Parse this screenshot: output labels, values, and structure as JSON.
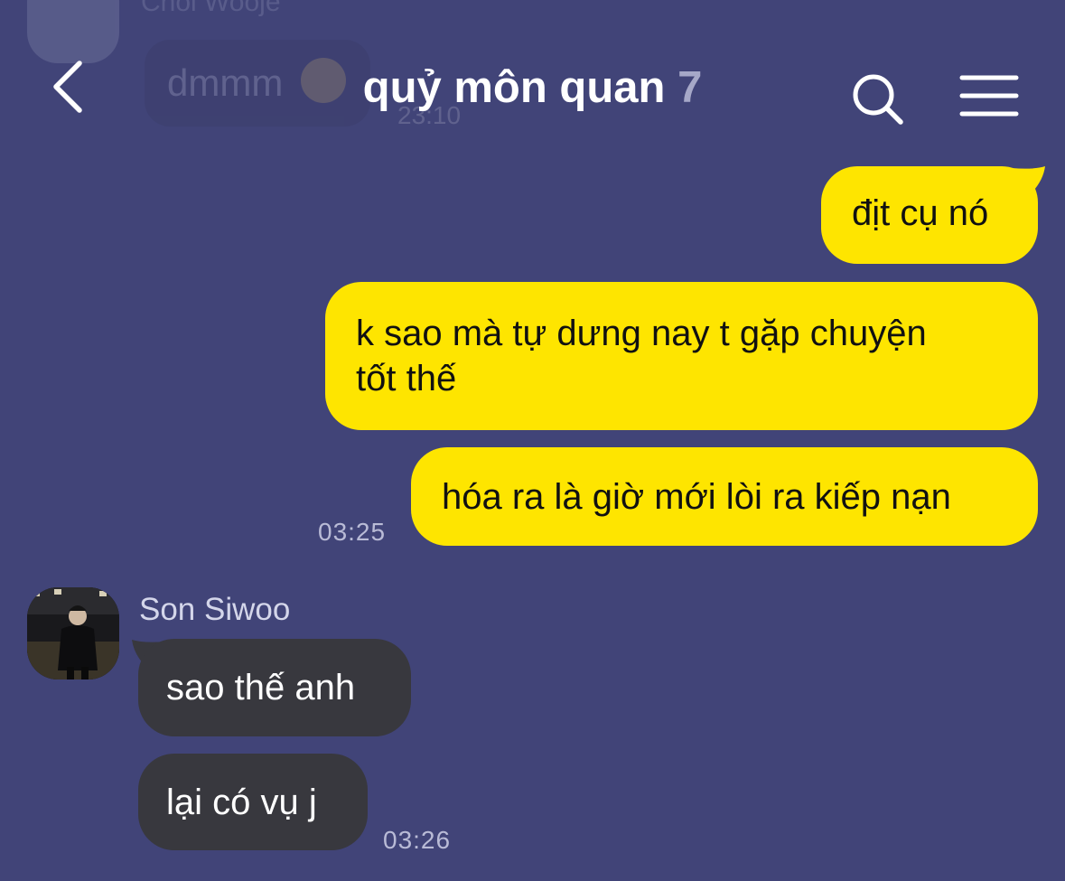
{
  "previous_message": {
    "sender": "Choi Wooje",
    "text": "dmmm",
    "time": "23:10"
  },
  "header": {
    "title": "quỷ môn quan",
    "member_count": "7",
    "back_icon": "chevron-left-icon",
    "search_icon": "search-icon",
    "menu_icon": "hamburger-menu-icon"
  },
  "messages": {
    "sent": [
      {
        "text": "địt cụ nó"
      },
      {
        "text_lines": [
          "k sao mà tự dưng nay t gặp chuyện",
          "tốt thế"
        ]
      },
      {
        "text": "hóa ra là giờ mới lòi ra kiếp nạn"
      }
    ],
    "sent_time": "03:25",
    "received_group": {
      "sender": "Son Siwoo",
      "messages": [
        {
          "text": "sao thế anh"
        },
        {
          "text": "lại có vụ j"
        }
      ],
      "time": "03:26"
    }
  },
  "colors": {
    "background": "#414478",
    "sent_bubble": "#fee500",
    "received_bubble": "#38383e",
    "timestamp": "#b9bbd6",
    "member_count": "#a6a8c8"
  }
}
